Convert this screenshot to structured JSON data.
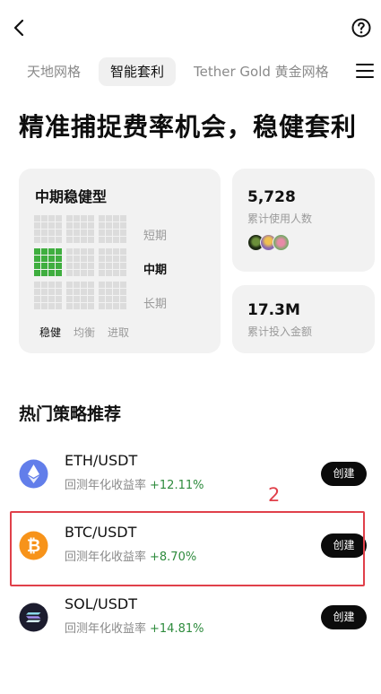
{
  "header": {
    "back_icon": "chevron-left-icon",
    "help_icon": "question-circle-icon"
  },
  "tabs": [
    {
      "label": "天地网格",
      "active": false
    },
    {
      "label": "智能套利",
      "active": true
    },
    {
      "label": "Tether Gold 黄金网格",
      "active": false
    }
  ],
  "menu_icon": "hamburger-menu-icon",
  "hero": {
    "title": "精准捕捉费率机会，稳健套利"
  },
  "strategy_card": {
    "title": "中期稳健型",
    "periods": [
      {
        "label": "短期",
        "active": false
      },
      {
        "label": "中期",
        "active": true
      },
      {
        "label": "长期",
        "active": false
      }
    ],
    "risk_levels": [
      {
        "label": "稳健",
        "active": true
      },
      {
        "label": "均衡",
        "active": false
      },
      {
        "label": "进取",
        "active": false
      }
    ],
    "colors": {
      "highlight": "#3fae3f",
      "inactive": "#dcdcdc"
    }
  },
  "users_card": {
    "value": "5,728",
    "label": "累计使用人数"
  },
  "amount_card": {
    "value": "17.3M",
    "label": "累计投入金额"
  },
  "section": {
    "title": "热门策略推荐"
  },
  "strategies": [
    {
      "pair": "ETH/USDT",
      "yield_label": "回测年化收益率",
      "yield_value": "+12.11%",
      "button": "创建",
      "icon": "ethereum-icon",
      "color": "#627eea"
    },
    {
      "pair": "BTC/USDT",
      "yield_label": "回测年化收益率",
      "yield_value": "+8.70%",
      "button": "创建",
      "icon": "bitcoin-icon",
      "color": "#f7931a"
    },
    {
      "pair": "SOL/USDT",
      "yield_label": "回测年化收益率",
      "yield_value": "+14.81%",
      "button": "创建",
      "icon": "solana-icon",
      "color": "#1c1c2e"
    }
  ],
  "annotation": {
    "label": "2",
    "color": "#e0404a"
  }
}
